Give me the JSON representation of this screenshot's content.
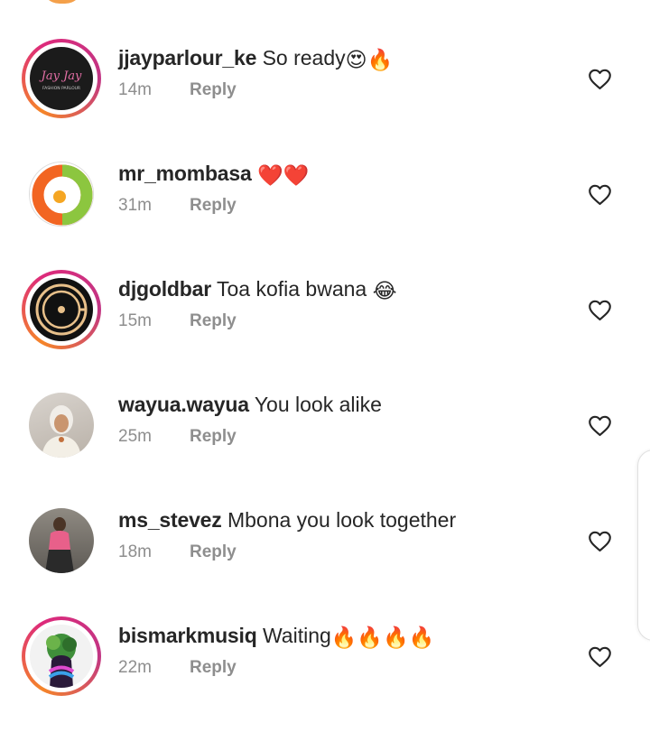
{
  "comments": [
    {
      "username": "jjayparlour_ke",
      "text": "So ready",
      "emojis": [
        "😍",
        "🔥"
      ],
      "time": "14m",
      "reply": "Reply",
      "avatar_text": "Jay Jay",
      "avatar_subtext": "FASHION PARLOUR"
    },
    {
      "username": "mr_mombasa",
      "text": "",
      "emojis": [
        "❤️",
        "❤️"
      ],
      "time": "31m",
      "reply": "Reply"
    },
    {
      "username": "djgoldbar",
      "text": "Toa kofia bwana",
      "emojis": [
        "😂"
      ],
      "time": "15m",
      "reply": "Reply"
    },
    {
      "username": "wayua.wayua",
      "text": "You look alike",
      "emojis": [],
      "time": "25m",
      "reply": "Reply"
    },
    {
      "username": "ms_stevez",
      "text": "Mbona you look together",
      "emojis": [],
      "time": "18m",
      "reply": "Reply"
    },
    {
      "username": "bismarkmusiq",
      "text": "Waiting",
      "emojis": [
        "🔥",
        "🔥",
        "🔥",
        "🔥"
      ],
      "time": "22m",
      "reply": "Reply"
    }
  ],
  "icons": {
    "like": "heart-outline-icon"
  },
  "colors": {
    "username": "#262626",
    "meta": "#8e8e8e",
    "story_ring_start": "#f58529",
    "story_ring_end": "#dd2a7b"
  }
}
